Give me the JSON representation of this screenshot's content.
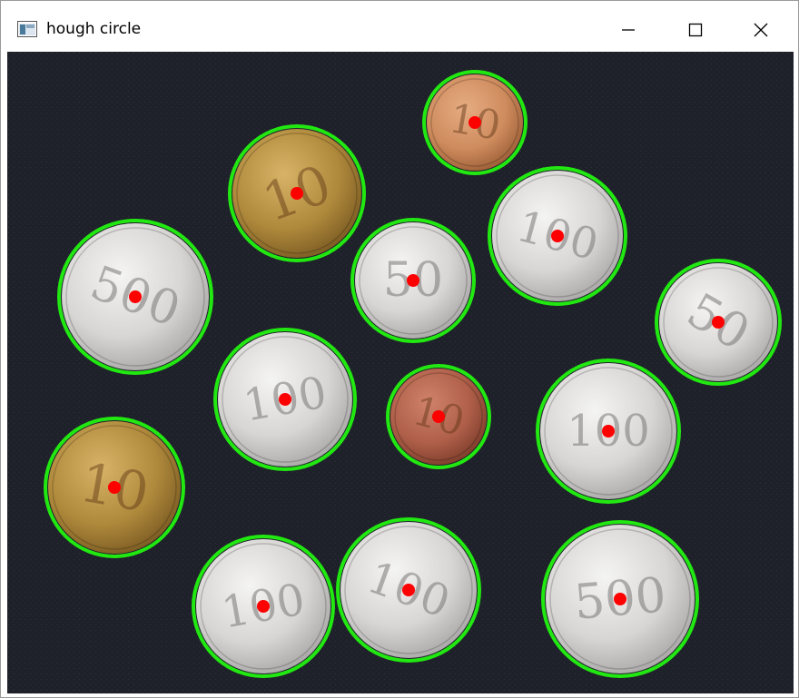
{
  "window": {
    "title": "hough circle",
    "controls": {
      "minimize": "minimize",
      "maximize": "maximize",
      "close": "close"
    }
  },
  "colors": {
    "background": "#1e2129",
    "circle": "#22e812",
    "center": "#ff0000"
  },
  "coins": [
    {
      "value": "10",
      "metal": "bronze"
    },
    {
      "value": "10",
      "metal": "brass"
    },
    {
      "value": "100",
      "metal": "silver"
    },
    {
      "value": "500",
      "metal": "silver"
    },
    {
      "value": "50",
      "metal": "silver"
    },
    {
      "value": "50",
      "metal": "silver"
    },
    {
      "value": "100",
      "metal": "silver"
    },
    {
      "value": "10",
      "metal": "copper"
    },
    {
      "value": "100",
      "metal": "silver"
    },
    {
      "value": "10",
      "metal": "brass"
    },
    {
      "value": "100",
      "metal": "silver"
    },
    {
      "value": "100",
      "metal": "silver"
    },
    {
      "value": "500",
      "metal": "silver"
    }
  ]
}
